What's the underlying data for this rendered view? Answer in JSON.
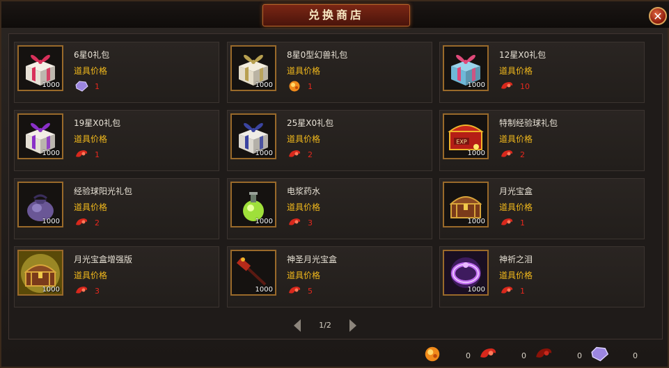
{
  "window": {
    "title": "兑换商店",
    "close_label": "✕"
  },
  "price_label": "道具价格",
  "items": [
    {
      "name": "6星0礼包",
      "qty": "1000",
      "price": "1",
      "icon": "pink-gift-box-icon",
      "currency": "purple-gem-icon"
    },
    {
      "name": "8星0型幻兽礼包",
      "qty": "1000",
      "price": "1",
      "icon": "gold-gift-box-icon",
      "currency": "orange-gem-icon"
    },
    {
      "name": "12星X0礼包",
      "qty": "1000",
      "price": "10",
      "icon": "blue-pink-gift-box-icon",
      "currency": "red-claw-icon"
    },
    {
      "name": "19星X0礼包",
      "qty": "1000",
      "price": "1",
      "icon": "purple-gift-box-icon",
      "currency": "red-claw-icon"
    },
    {
      "name": "25星X0礼包",
      "qty": "1000",
      "price": "2",
      "icon": "navy-gift-box-icon",
      "currency": "red-claw-icon"
    },
    {
      "name": "特制经验球礼包",
      "qty": "1000",
      "price": "2",
      "icon": "exp-chest-icon",
      "currency": "red-claw-icon"
    },
    {
      "name": "经验球阳光礼包",
      "qty": "1000",
      "price": "2",
      "icon": "purple-pouch-icon",
      "currency": "red-claw-icon"
    },
    {
      "name": "电浆药水",
      "qty": "1000",
      "price": "3",
      "icon": "green-potion-icon",
      "currency": "red-claw-icon"
    },
    {
      "name": "月光宝盒",
      "qty": "1000",
      "price": "1",
      "icon": "treasure-chest-icon",
      "currency": "red-claw-icon"
    },
    {
      "name": "月光宝盒增强版",
      "qty": "1000",
      "price": "3",
      "icon": "glowing-chest-icon",
      "currency": "red-claw-icon"
    },
    {
      "name": "神圣月光宝盒",
      "qty": "1000",
      "price": "5",
      "icon": "red-hammer-icon",
      "currency": "red-claw-icon"
    },
    {
      "name": "神祈之泪",
      "qty": "1000",
      "price": "1",
      "icon": "purple-ring-icon",
      "currency": "red-claw-icon"
    }
  ],
  "pagination": {
    "text": "1/2",
    "prev_icon": "arrow-left-icon",
    "next_icon": "arrow-right-icon"
  },
  "balances": [
    {
      "icon": "orange-gem-icon",
      "value": "0"
    },
    {
      "icon": "red-claw-icon",
      "value": "0"
    },
    {
      "icon": "red-claw-dark-icon",
      "value": "0"
    },
    {
      "icon": "purple-gem-icon",
      "value": "0"
    }
  ],
  "colors": {
    "price_label": "#f2b91c",
    "price_value": "#e8281e",
    "slot_border": "#9a6a2a",
    "title_banner": "#7a2614"
  }
}
